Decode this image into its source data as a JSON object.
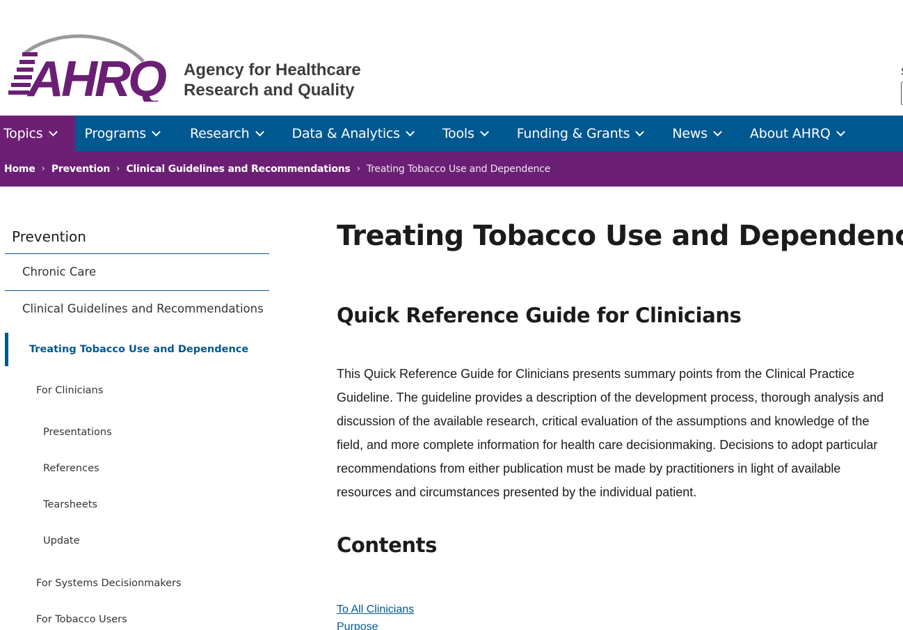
{
  "header": {
    "logo_text": "AHRQ",
    "agency_line1": "Agency for Healthcare",
    "agency_line2": "Research and Quality",
    "search_label_partial": "S"
  },
  "colors": {
    "nav_blue": "#005891",
    "brand_purple": "#6b1f74",
    "logo_gray": "#9a9a9a"
  },
  "nav": {
    "items": [
      {
        "label": "Topics"
      },
      {
        "label": "Programs"
      },
      {
        "label": "Research"
      },
      {
        "label": "Data & Analytics"
      },
      {
        "label": "Tools"
      },
      {
        "label": "Funding & Grants"
      },
      {
        "label": "News"
      },
      {
        "label": "About AHRQ"
      }
    ]
  },
  "breadcrumb": {
    "items": [
      {
        "label": "Home"
      },
      {
        "label": "Prevention"
      },
      {
        "label": "Clinical Guidelines and Recommendations"
      },
      {
        "label": "Treating Tobacco Use and Dependence"
      }
    ]
  },
  "sidebar": {
    "title": "Prevention",
    "chronic_care": "Chronic Care",
    "clinical_guidelines": "Clinical Guidelines and Recommendations",
    "treating_tobacco": "Treating Tobacco Use and Dependence",
    "for_clinicians": "For Clinicians",
    "presentations": "Presentations",
    "references": "References",
    "tearsheets": "Tearsheets",
    "update": "Update",
    "for_systems": "For Systems Decisionmakers",
    "for_tobacco_users": "For Tobacco Users"
  },
  "main": {
    "title": "Treating Tobacco Use and Dependence",
    "subtitle": "Quick Reference Guide for Clinicians",
    "intro": "This Quick Reference Guide for Clinicians presents summary points from the Clinical Practice Guideline. The guideline provides a description of the development process, thorough analysis and discussion of the available research, critical evaluation of the assumptions and knowledge of the field, and more complete information for health care decisionmaking. Decisions to adopt particular recommendations from either publication must be made by practitioners in light of available resources and circumstances presented by the individual patient.",
    "contents_heading": "Contents",
    "toc": [
      {
        "label": "To All Clinicians"
      },
      {
        "label": "Purpose"
      }
    ]
  }
}
